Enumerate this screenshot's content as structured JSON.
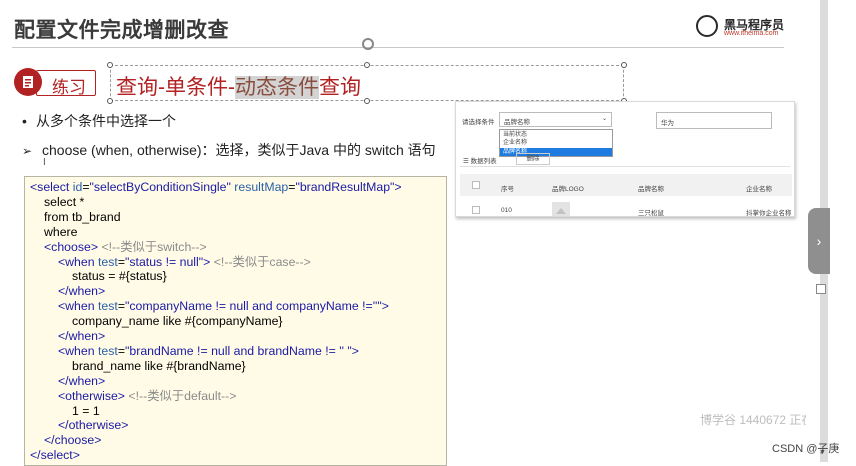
{
  "slide": {
    "title": "配置文件完成增删改查",
    "logo": {
      "name": "黑马程序员",
      "url": "www.itheima.com"
    },
    "badge_label": "练习",
    "heading": {
      "part1": "查询-单条件-",
      "highlight": "动态条件",
      "part2": "查询"
    },
    "bullets": [
      "从多个条件中选择一个",
      "choose (when, otherwise)：选择，类似于Java 中的 switch 语句"
    ],
    "bullet_markers": {
      "dot": "•",
      "arrow": "➢"
    }
  },
  "code": {
    "lines": [
      {
        "indent": 0,
        "segs": [
          [
            "tag",
            "<select "
          ],
          [
            "attr",
            "id"
          ],
          [
            "txt",
            "="
          ],
          [
            "val",
            "\"selectByConditionSingle\""
          ],
          [
            "txt",
            " "
          ],
          [
            "attr",
            "resultMap"
          ],
          [
            "txt",
            "="
          ],
          [
            "val",
            "\"brandResultMap\""
          ],
          [
            "tag",
            ">"
          ]
        ]
      },
      {
        "indent": 1,
        "segs": [
          [
            "txt",
            "select *"
          ]
        ]
      },
      {
        "indent": 1,
        "segs": [
          [
            "txt",
            "from tb_brand"
          ]
        ]
      },
      {
        "indent": 1,
        "segs": [
          [
            "txt",
            "where"
          ]
        ]
      },
      {
        "indent": 1,
        "segs": [
          [
            "tag",
            "<choose>"
          ],
          [
            "txt",
            "  "
          ],
          [
            "cmt",
            "<!--类似于switch-->"
          ]
        ]
      },
      {
        "indent": 2,
        "segs": [
          [
            "tag",
            "<when "
          ],
          [
            "attr",
            "test"
          ],
          [
            "txt",
            "="
          ],
          [
            "val",
            "\"status != null\""
          ],
          [
            "tag",
            ">"
          ],
          [
            "txt",
            "  "
          ],
          [
            "cmt",
            "<!--类似于case-->"
          ]
        ]
      },
      {
        "indent": 3,
        "segs": [
          [
            "txt",
            "status = #{status}"
          ]
        ]
      },
      {
        "indent": 2,
        "segs": [
          [
            "tag",
            "</when>"
          ]
        ]
      },
      {
        "indent": 2,
        "segs": [
          [
            "tag",
            "<when "
          ],
          [
            "attr",
            "test"
          ],
          [
            "txt",
            "="
          ],
          [
            "val",
            "\"companyName != null and companyName !=''\""
          ],
          [
            "tag",
            ">"
          ]
        ]
      },
      {
        "indent": 3,
        "segs": [
          [
            "txt",
            "company_name like #{companyName}"
          ]
        ]
      },
      {
        "indent": 2,
        "segs": [
          [
            "tag",
            "</when>"
          ]
        ]
      },
      {
        "indent": 2,
        "segs": [
          [
            "tag",
            "<when "
          ],
          [
            "attr",
            "test"
          ],
          [
            "txt",
            "="
          ],
          [
            "val",
            "\"brandName != null and brandName != '' \""
          ],
          [
            "tag",
            ">"
          ]
        ]
      },
      {
        "indent": 3,
        "segs": [
          [
            "txt",
            "brand_name like #{brandName}"
          ]
        ]
      },
      {
        "indent": 2,
        "segs": [
          [
            "tag",
            "</when>"
          ]
        ]
      },
      {
        "indent": 2,
        "segs": [
          [
            "tag",
            "<otherwise>"
          ],
          [
            "txt",
            "  "
          ],
          [
            "cmt",
            "<!--类似于default-->"
          ]
        ]
      },
      {
        "indent": 3,
        "segs": [
          [
            "txt",
            "1 = 1"
          ]
        ]
      },
      {
        "indent": 2,
        "segs": [
          [
            "tag",
            "</otherwise>"
          ]
        ]
      },
      {
        "indent": 1,
        "segs": [
          [
            "tag",
            "</choose>"
          ]
        ]
      },
      {
        "indent": 0,
        "segs": [
          [
            "tag",
            "</select>"
          ]
        ]
      }
    ]
  },
  "screenshot": {
    "select_label": "请选择条件",
    "select_value": "品牌名称",
    "options": [
      "当前状态",
      "企业名称",
      "品牌名称"
    ],
    "selected_option": 2,
    "search_value": "华为",
    "list_label": "数据列表",
    "delete_button": "删除",
    "columns": [
      "序号",
      "品牌LOGO",
      "品牌名称",
      "企业名称"
    ],
    "rows": [
      {
        "index": "010",
        "brand": "三只松鼠",
        "company": "抖掌你企业名称"
      }
    ]
  },
  "sidebar": {
    "toggle_icon": "chevron-right-icon"
  },
  "watermark": "博学谷 1440672 正在观",
  "credit": "CSDN @子庚"
}
